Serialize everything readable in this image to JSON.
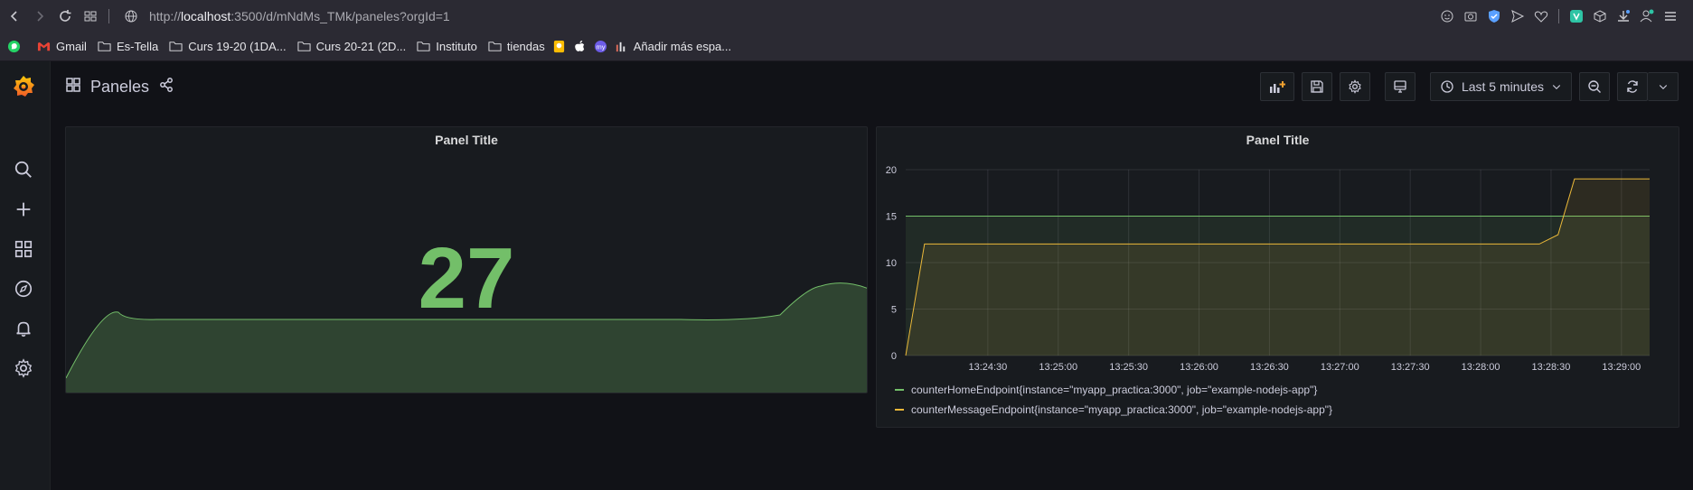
{
  "browser": {
    "url_prefix": "http://",
    "url_host": "localhost",
    "url_rest": ":3500/d/mNdMs_TMk/paneles?orgId=1"
  },
  "bookmarks": [
    {
      "label": "",
      "icon": "whatsapp-icon"
    },
    {
      "label": "Gmail",
      "icon": "gmail-icon"
    },
    {
      "label": "Es-Tella",
      "icon": "folder-icon"
    },
    {
      "label": "Curs 19-20 (1DA...",
      "icon": "folder-icon"
    },
    {
      "label": "Curs 20-21 (2D...",
      "icon": "folder-icon"
    },
    {
      "label": "Instituto",
      "icon": "folder-icon"
    },
    {
      "label": "tiendas",
      "icon": "folder-icon"
    },
    {
      "label": "",
      "icon": "keep-icon"
    },
    {
      "label": "",
      "icon": "apple-icon"
    },
    {
      "label": "",
      "icon": "my-icon"
    },
    {
      "label": "Añadir más espa...",
      "icon": "bars-icon"
    }
  ],
  "dashboard": {
    "title": "Paneles",
    "time_range": "Last 5 minutes"
  },
  "panels": {
    "stat": {
      "title": "Panel Title",
      "value": "27"
    },
    "graph": {
      "title": "Panel Title"
    }
  },
  "colors": {
    "green": "#73bf69",
    "yellow": "#eab839"
  },
  "chart_data": {
    "type": "line",
    "title": "Panel Title",
    "ylim": [
      0,
      20
    ],
    "y_ticks": [
      "0",
      "5",
      "10",
      "15",
      "20"
    ],
    "x_ticks": [
      "13:24:30",
      "13:25:00",
      "13:25:30",
      "13:26:00",
      "13:26:30",
      "13:27:00",
      "13:27:30",
      "13:28:00",
      "13:28:30",
      "13:29:00"
    ],
    "x_range_seconds": [
      -5,
      312
    ],
    "series": [
      {
        "name": "counterHomeEndpoint{instance=\"myapp_practica:3000\", job=\"example-nodejs-app\"}",
        "color": "#73bf69",
        "x": [
          -5,
          312
        ],
        "y": [
          15,
          15
        ]
      },
      {
        "name": "counterMessageEndpoint{instance=\"myapp_practica:3000\", job=\"example-nodejs-app\"}",
        "color": "#eab839",
        "x": [
          -5,
          3,
          265,
          273,
          280,
          312
        ],
        "y": [
          0,
          12,
          12,
          13,
          19,
          19
        ]
      }
    ],
    "grid": true,
    "legend": "bottom-left"
  }
}
